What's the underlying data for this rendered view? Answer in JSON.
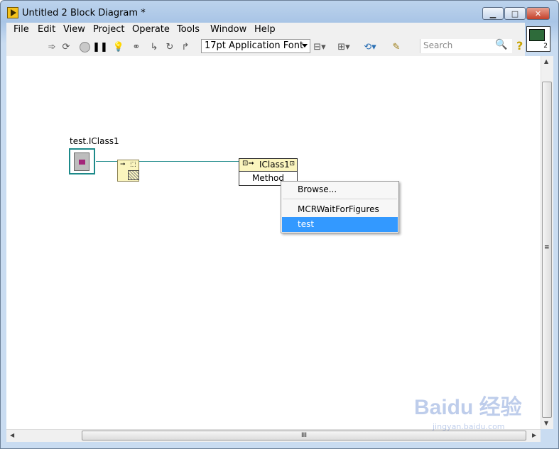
{
  "window": {
    "title": "Untitled 2 Block Diagram *"
  },
  "menubar": {
    "items": [
      "File",
      "Edit",
      "View",
      "Project",
      "Operate",
      "Tools",
      "Window",
      "Help"
    ]
  },
  "toolbar": {
    "font_select": "17pt Application Font",
    "search_placeholder": "Search",
    "vi_icon_number": "2",
    "icons": [
      "run-arrow-icon",
      "run-continuous-icon",
      "abort-icon",
      "pause-icon",
      "highlight-execution-icon",
      "retain-wire-values-icon",
      "step-into-icon",
      "step-over-icon",
      "step-out-icon",
      "align-icon",
      "distribute-icon",
      "reorder-icon",
      "cleanup-icon",
      "search-icon",
      "help-icon"
    ]
  },
  "diagram": {
    "class_constant_label": "test.IClass1",
    "invoke_node_class": "IClass1",
    "invoke_node_method": "Method",
    "wire_color": "#1d8a8a"
  },
  "context_menu": {
    "items": [
      {
        "label": "Browse...",
        "selected": false
      },
      {
        "label": "MCRWaitForFigures",
        "selected": false
      },
      {
        "label": "test",
        "selected": true
      }
    ]
  },
  "scroll": {
    "hscroll_grip": "III",
    "vscroll_grip": "≡"
  },
  "watermark": {
    "brand": "Baidu 经验",
    "url": "jingyan.baidu.com"
  }
}
